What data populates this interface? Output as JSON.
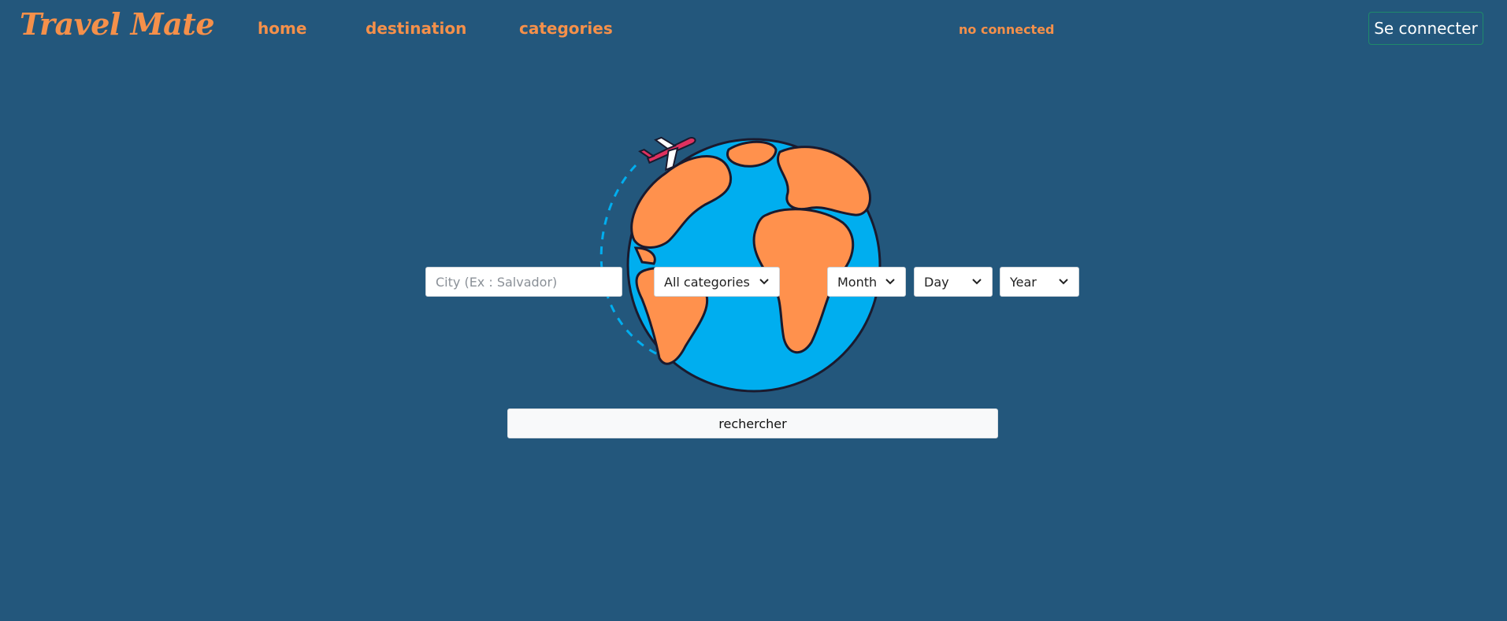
{
  "navbar": {
    "brand": "Travel Mate",
    "links": [
      {
        "label": "home"
      },
      {
        "label": "destination"
      },
      {
        "label": "categories"
      }
    ],
    "status": "no connected",
    "login_label": "Se connecter"
  },
  "search": {
    "city_placeholder": "City (Ex : Salvador)",
    "category_value": "All categories",
    "month_value": "Month",
    "day_value": "Day",
    "year_value": "Year",
    "submit_label": "rechercher"
  },
  "colors": {
    "background": "#23577c",
    "accent": "#f5904a",
    "ocean": "#00aeef",
    "land": "#ff914d"
  },
  "illustration": {
    "icon": "globe-with-airplane"
  }
}
